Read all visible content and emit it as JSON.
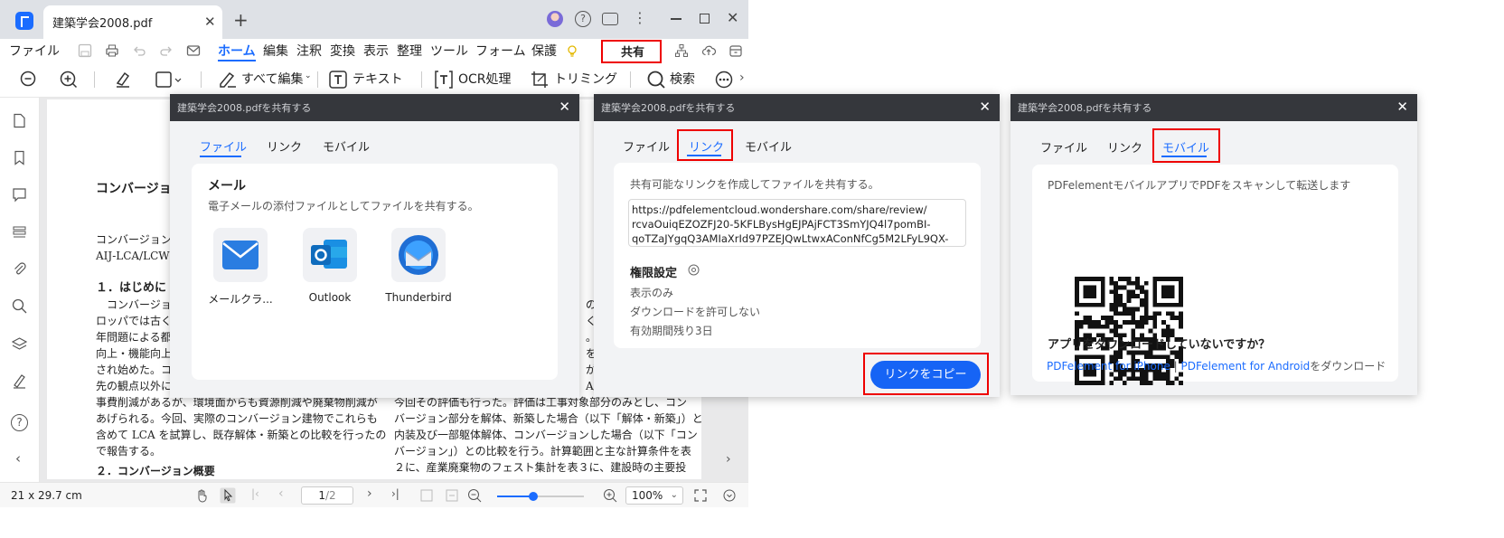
{
  "window": {
    "tab_title": "建築学会2008.pdf",
    "new_tab": "+"
  },
  "menu": {
    "file": "ファイル",
    "items": [
      "ホーム",
      "編集",
      "注釈",
      "変換",
      "表示",
      "整理",
      "ツール",
      "フォーム",
      "保護"
    ],
    "share": "共有"
  },
  "toolbar": {
    "edit_all": "すべて編集",
    "text": "テキスト",
    "ocr": "OCR処理",
    "trim": "トリミング",
    "search": "検索"
  },
  "document": {
    "heading": "コンバージョン",
    "para1": [
      "コンバージョン",
      "AIJ-LCA/LCW ツー"
    ],
    "section": "１．はじめに",
    "left_lines": [
      "　コンバージョ",
      "ロッパでは古くか",
      "年問題による都心",
      "向上・機能向上を",
      "され始めた。コン",
      "先の観点以外に",
      "事費削減があるが、環境面からも資源削減や廃棄物削減が",
      "あげられる。今回、実際のコンバージョン建物でこれらも",
      "含めて LCA を試算し、既存解体・新築との比較を行ったの",
      "で報告する。"
    ],
    "left_tail": "２．コンバージョン概要",
    "right_frag": [
      "の",
      "く価",
      "。CO",
      "を占",
      "が",
      "A/L"
    ],
    "right_lines": [
      "今回その評価も行った。評価は工事対象部分のみとし、コン",
      "バージョン部分を解体、新築した場合（以下「解体・新築」）と、",
      "内装及び一部躯体解体、コンバージョンした場合（以下「コン",
      "バージョン」）との比較を行う。計算範囲と主な計算条件を表",
      "２に、産業廃棄物のフェスト集計を表３に、建設時の主要投"
    ]
  },
  "status": {
    "page_size": "21 x 29.7 cm",
    "page_current": "1",
    "page_total": "/2",
    "zoom": "100%",
    "zoom_level": 0.42
  },
  "dialog_file": {
    "title": "建築学会2008.pdfを共有する",
    "tabs": [
      "ファイル",
      "リンク",
      "モバイル"
    ],
    "section_title": "メール",
    "section_desc": "電子メールの添付ファイルとしてファイルを共有する。",
    "apps": [
      "メールクラ...",
      "Outlook",
      "Thunderbird"
    ]
  },
  "dialog_link": {
    "title": "建築学会2008.pdfを共有する",
    "tabs": [
      "ファイル",
      "リンク",
      "モバイル"
    ],
    "desc": "共有可能なリンクを作成してファイルを共有する。",
    "url_lines": [
      "https://pdfelementcloud.wondershare.com/share/review/",
      "rcvaOuiqEZOZFJ20-5KFLBysHgEJPAjFCT3SmYJQ4l7pomBI-",
      "qoTZaJYgqQ3AMIaXrId97PZEJQwLtwxAConNfCg5M2LFyL9QX-"
    ],
    "perm_title": "権限設定",
    "perms": [
      "表示のみ",
      "ダウンロードを許可しない",
      "有効期間残り3日"
    ],
    "copy_button": "リンクをコピー"
  },
  "dialog_mobile": {
    "title": "建築学会2008.pdfを共有する",
    "tabs": [
      "ファイル",
      "リンク",
      "モバイル"
    ],
    "desc": "PDFelementモバイルアプリでPDFをスキャンして転送します",
    "question": "アプリをダウンロードしていないですか？",
    "link_iphone": "PDFelement for iPhone",
    "sep": "|",
    "link_android": "PDFelement for Android",
    "suffix": "をダウンロード"
  },
  "colors": {
    "accent": "#1b6cff",
    "highlight": "#ee0000",
    "dialog_header": "#35373c"
  },
  "icons": [
    "app-logo-icon",
    "help-icon",
    "feedback-icon",
    "more-icon",
    "minimize-icon",
    "maximize-icon",
    "close-icon",
    "save-icon",
    "print-icon",
    "undo-icon",
    "redo-icon",
    "mail-icon",
    "bulb-icon",
    "zoom-out-icon",
    "zoom-in-icon",
    "highlighter-icon",
    "shape-icon",
    "edit-icon",
    "text-icon",
    "ocr-icon",
    "crop-icon",
    "search-icon",
    "more-circle-icon",
    "page-icon",
    "bookmark-icon",
    "comment-icon",
    "layers-icon",
    "attachment-icon",
    "signature-icon",
    "hand-icon",
    "select-icon",
    "mail-app-icon",
    "outlook-icon",
    "thunderbird-icon",
    "qr-code-icon"
  ]
}
